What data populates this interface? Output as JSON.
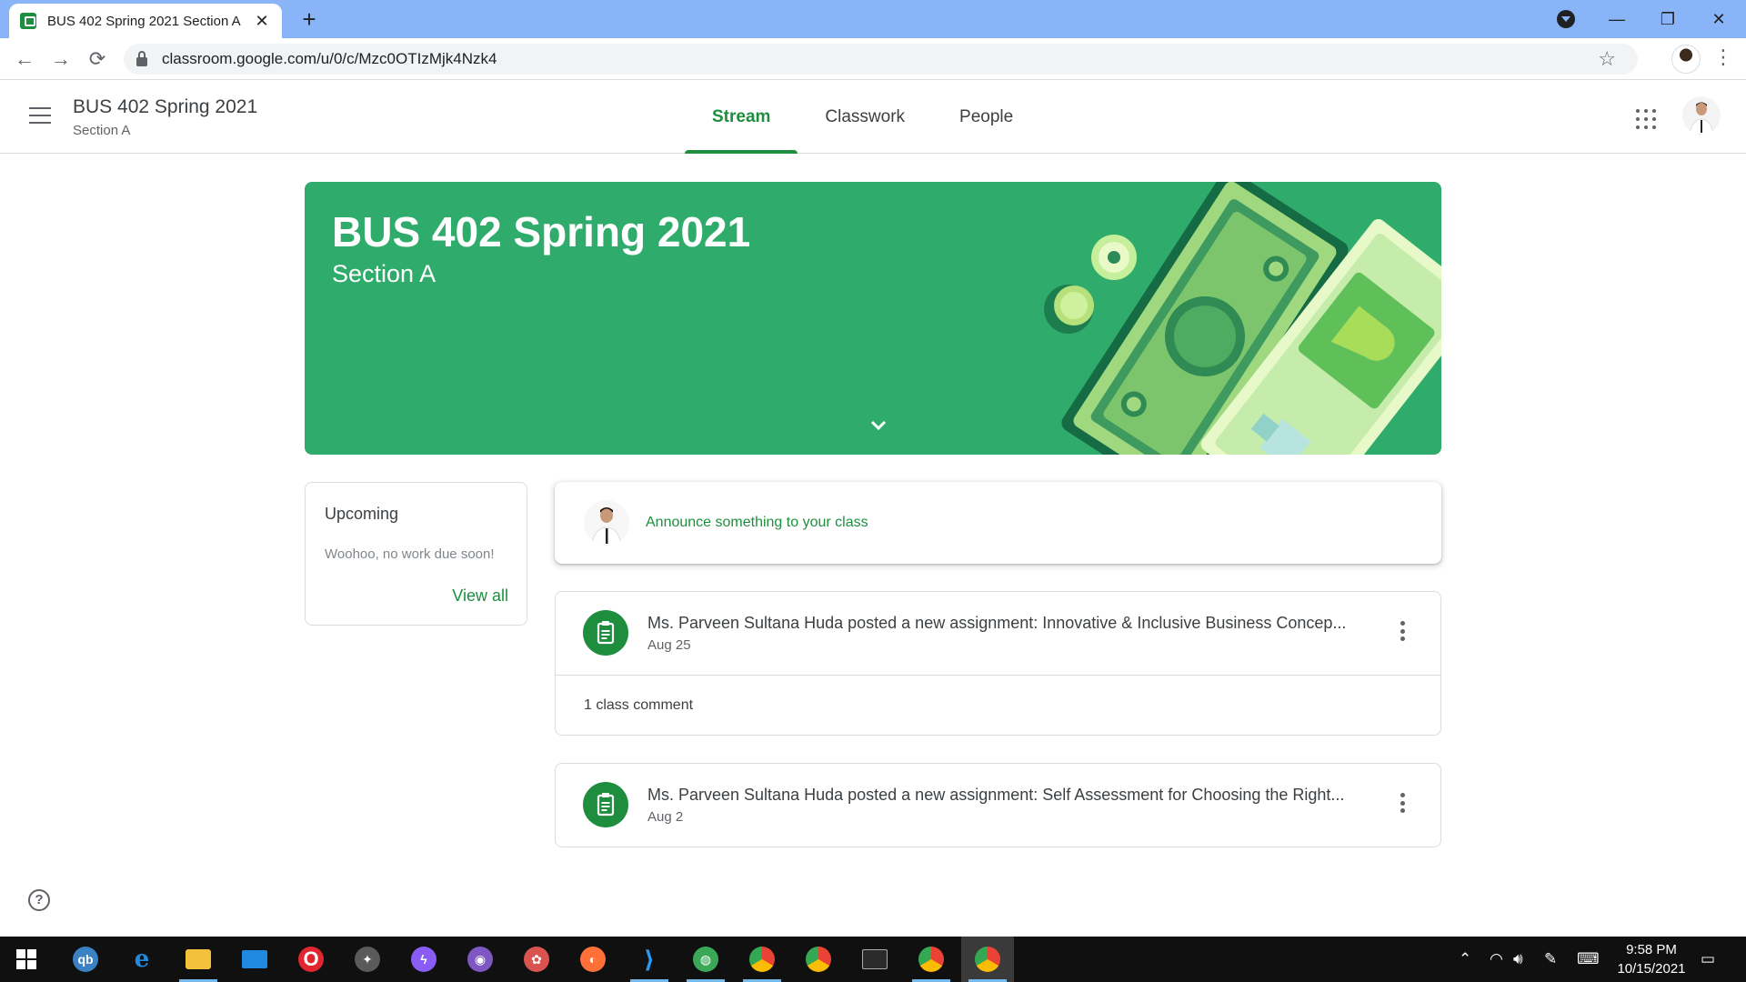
{
  "browser": {
    "tab_title": "BUS 402 Spring 2021 Section A",
    "tab_close": "✕",
    "new_tab": "+",
    "url": "classroom.google.com/u/0/c/Mzc0OTIzMjk4Nzk4",
    "window_controls": [
      "—",
      "❐",
      "✕"
    ],
    "nav": {
      "back": "←",
      "forward": "→",
      "reload": "⟳"
    },
    "star": "☆",
    "menu": "⋮"
  },
  "header": {
    "class_title": "BUS 402 Spring 2021",
    "class_section": "Section A",
    "tabs": [
      {
        "label": "Stream",
        "active": true
      },
      {
        "label": "Classwork",
        "active": false
      },
      {
        "label": "People",
        "active": false
      }
    ]
  },
  "banner": {
    "title": "BUS 402 Spring 2021",
    "subtitle": "Section A",
    "color": "#2fac6b"
  },
  "upcoming": {
    "title": "Upcoming",
    "message": "Woohoo, no work due soon!",
    "link": "View all"
  },
  "announce": {
    "placeholder": "Announce something to your class"
  },
  "posts": [
    {
      "title": "Ms. Parveen Sultana Huda posted a new assignment: Innovative & Inclusive Business Concep...",
      "date": "Aug 25",
      "comments": "1 class comment"
    },
    {
      "title": "Ms. Parveen Sultana Huda posted a new assignment: Self Assessment for Choosing the Right...",
      "date": "Aug 2"
    }
  ],
  "help": "?",
  "taskbar": {
    "apps": [
      "windows-start",
      "qbittorrent",
      "edge",
      "file-explorer",
      "mail",
      "opera",
      "satellite-app",
      "messenger",
      "github-desktop",
      "pinwheel-app",
      "firefox",
      "vscode",
      "globe-app",
      "chrome-profile-1",
      "chrome",
      "terminal",
      "chrome-profile-ek",
      "chrome-profile-active"
    ],
    "time": "9:58 PM",
    "date": "10/15/2021"
  },
  "colors": {
    "accent_green": "#1e8e3e",
    "tabbar_blue": "#8ab4f8",
    "taskbar": "#101010"
  }
}
